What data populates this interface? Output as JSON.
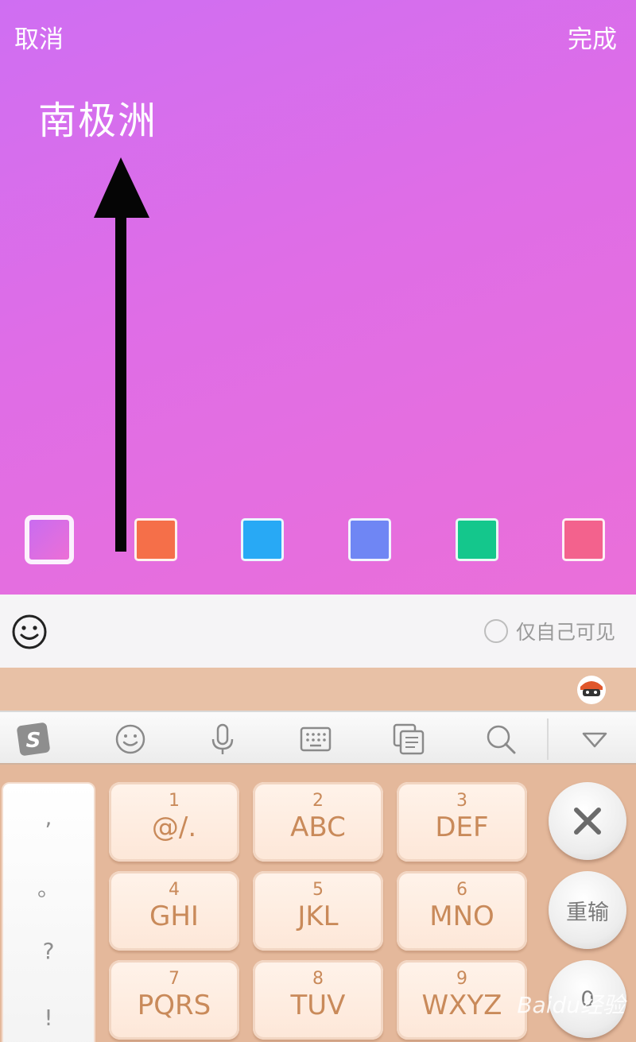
{
  "header": {
    "cancel_label": "取消",
    "done_label": "完成"
  },
  "editor": {
    "text": "南极洲"
  },
  "swatches": [
    {
      "color": "#d86ee8",
      "selected": true
    },
    {
      "color": "#f56f49"
    },
    {
      "color": "#28a9f5"
    },
    {
      "color": "#6f86f4"
    },
    {
      "color": "#14c78c"
    },
    {
      "color": "#f3628d"
    }
  ],
  "toolbar": {
    "private_label": "仅自己可见"
  },
  "keyboard": {
    "symbols": [
      ",",
      "。",
      "?",
      "!"
    ],
    "keys": [
      {
        "num": "1",
        "letters": "@/."
      },
      {
        "num": "2",
        "letters": "ABC"
      },
      {
        "num": "3",
        "letters": "DEF"
      },
      {
        "num": "4",
        "letters": "GHI"
      },
      {
        "num": "5",
        "letters": "JKL"
      },
      {
        "num": "6",
        "letters": "MNO"
      },
      {
        "num": "7",
        "letters": "PQRS"
      },
      {
        "num": "8",
        "letters": "TUV"
      },
      {
        "num": "9",
        "letters": "WXYZ"
      }
    ],
    "reinput_label": "重输",
    "zero_label": "0"
  },
  "watermark": "Baidu经验"
}
